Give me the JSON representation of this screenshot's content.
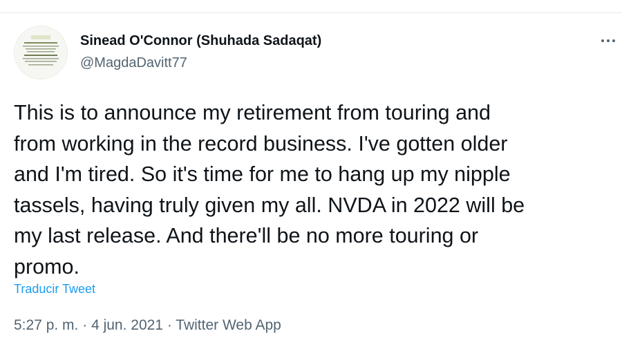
{
  "tweet": {
    "display_name": "Sinead O'Connor (Shuhada Sadaqat)",
    "handle": "@MagdaDavitt77",
    "text": "This is to announce my retirement from touring and\nfrom working in the record business. I've gotten older\nand I'm tired. So it's time for me to hang up my nipple\ntassels, having truly given my all. NVDA in 2022 will be\nmy last release. And there'll be no more touring or\npromo.",
    "translate_label": "Traducir Tweet",
    "time": "5:27 p. m.",
    "date": "4 jun. 2021",
    "separator": " · ",
    "source": "Twitter Web App"
  },
  "icons": {
    "avatar": "profile-avatar",
    "more": "more-options-icon"
  },
  "colors": {
    "text_primary": "#0f1419",
    "text_secondary": "#536471",
    "link": "#1d9bf0",
    "divider": "#e6ecf0"
  }
}
